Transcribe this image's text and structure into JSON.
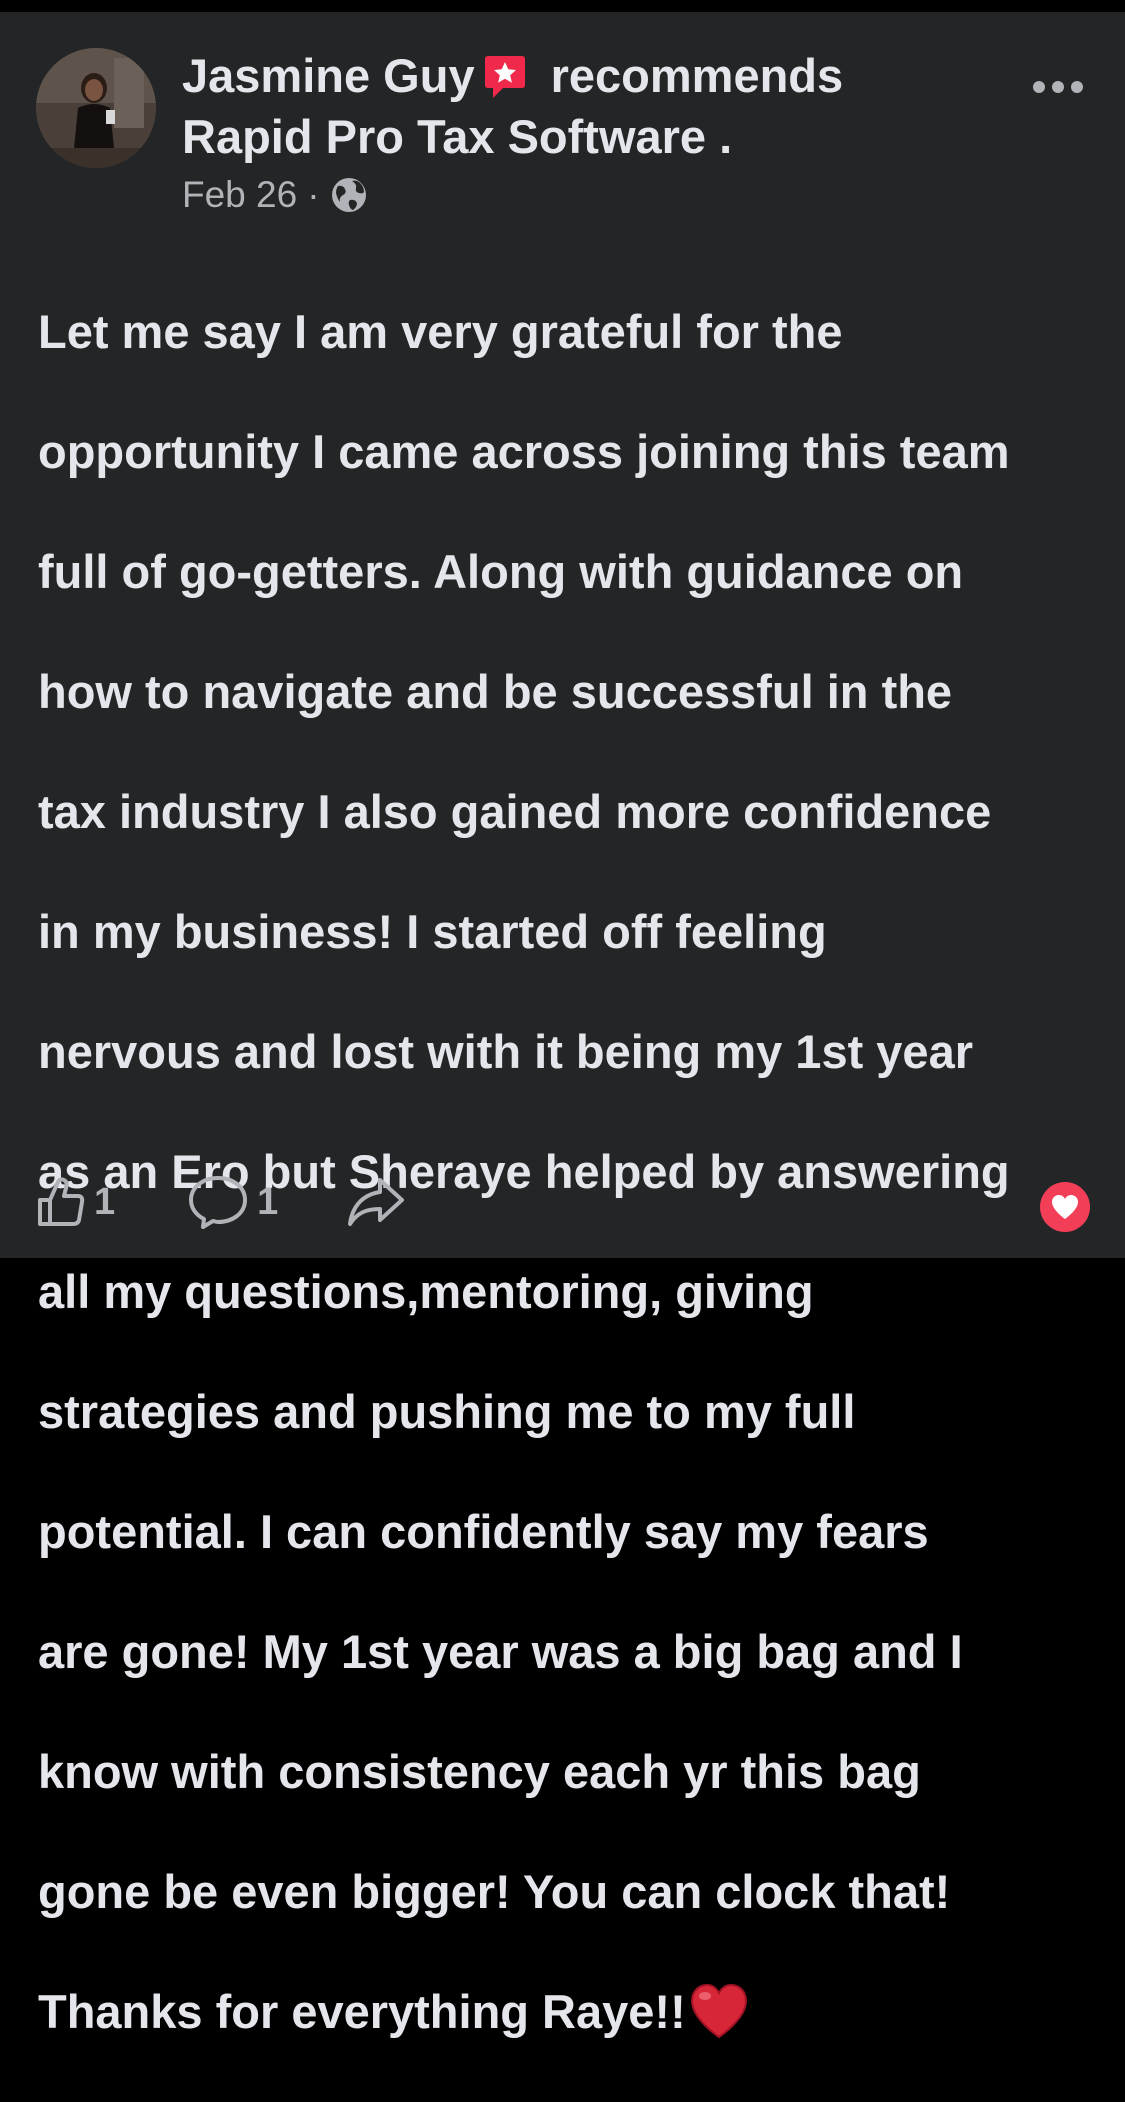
{
  "post": {
    "author": "Jasmine Guy",
    "recommend_icon": "recommend-star-icon",
    "action_text": "recommends",
    "page_name": "Rapid Pro Tax Software .",
    "date": "Feb 26",
    "separator": "·",
    "audience_icon": "globe-icon",
    "body_lines": [
      "Let me say I am very grateful for the",
      "opportunity I came across joining this team",
      "full of go-getters. Along with guidance on",
      "how to navigate and be successful in the",
      "tax industry I also gained more confidence",
      "in my business! I started off feeling",
      "nervous and lost with it being my 1st year",
      "as an Ero but Sheraye helped by answering",
      "all my questions,mentoring, giving",
      "strategies and pushing me to my full",
      "potential. I can confidently say my fears",
      "are gone! My 1st year was a big bag and I",
      "know with consistency each yr this bag",
      "gone be even bigger! You can clock that!"
    ],
    "body_last_line": "Thanks for everything Raye!!",
    "body_emoji": "red-heart-emoji"
  },
  "actions": {
    "like_count": "1",
    "comment_count": "1"
  },
  "reaction": {
    "icon": "love-reaction-icon",
    "color": "#F33E58"
  },
  "colors": {
    "background": "#242526",
    "text": "#E4E6EB",
    "secondary_text": "#B0B3B8"
  }
}
